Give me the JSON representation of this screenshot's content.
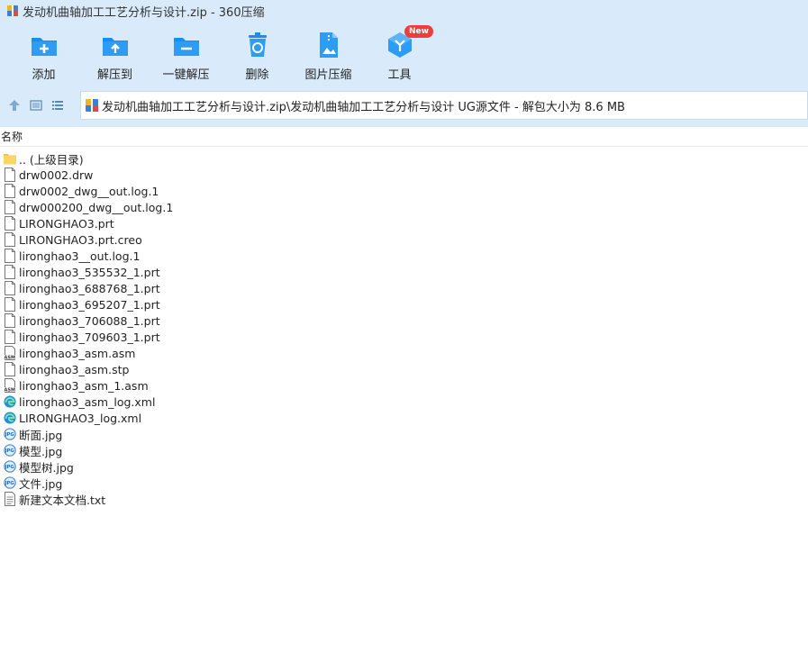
{
  "window": {
    "title": "发动机曲轴加工工艺分析与设计.zip - 360压缩"
  },
  "toolbar": [
    {
      "label": "添加",
      "icon": "add-folder-icon"
    },
    {
      "label": "解压到",
      "icon": "extract-to-icon"
    },
    {
      "label": "一键解压",
      "icon": "one-click-extract-icon"
    },
    {
      "label": "删除",
      "icon": "delete-icon"
    },
    {
      "label": "图片压缩",
      "icon": "image-compress-icon"
    },
    {
      "label": "工具",
      "icon": "tools-icon",
      "badge": "New"
    }
  ],
  "address": {
    "path": "发动机曲轴加工工艺分析与设计.zip\\发动机曲轴加工工艺分析与设计 UG源文件 - 解包大小为 8.6 MB"
  },
  "columns": {
    "name": "名称"
  },
  "files": [
    {
      "name": ".. (上级目录)",
      "type": "folder"
    },
    {
      "name": "drw0002.drw",
      "type": "file"
    },
    {
      "name": "drw0002_dwg__out.log.1",
      "type": "file"
    },
    {
      "name": "drw000200_dwg__out.log.1",
      "type": "file"
    },
    {
      "name": "LIRONGHAO3.prt",
      "type": "file"
    },
    {
      "name": "LIRONGHAO3.prt.creo",
      "type": "file"
    },
    {
      "name": "lironghao3__out.log.1",
      "type": "file"
    },
    {
      "name": "lironghao3_535532_1.prt",
      "type": "file"
    },
    {
      "name": "lironghao3_688768_1.prt",
      "type": "file"
    },
    {
      "name": "lironghao3_695207_1.prt",
      "type": "file"
    },
    {
      "name": "lironghao3_706088_1.prt",
      "type": "file"
    },
    {
      "name": "lironghao3_709603_1.prt",
      "type": "file"
    },
    {
      "name": "lironghao3_asm.asm",
      "type": "asm"
    },
    {
      "name": "lironghao3_asm.stp",
      "type": "file"
    },
    {
      "name": "lironghao3_asm_1.asm",
      "type": "asm"
    },
    {
      "name": "lironghao3_asm_log.xml",
      "type": "edge"
    },
    {
      "name": "LIRONGHAO3_log.xml",
      "type": "edge"
    },
    {
      "name": "断面.jpg",
      "type": "jpg"
    },
    {
      "name": "模型.jpg",
      "type": "jpg"
    },
    {
      "name": "模型树.jpg",
      "type": "jpg"
    },
    {
      "name": "文件.jpg",
      "type": "jpg"
    },
    {
      "name": "新建文本文档.txt",
      "type": "txt"
    }
  ],
  "colors": {
    "header_bg": "#d9ebfb",
    "accent": "#1a8df0",
    "badge": "#f23c3c"
  }
}
